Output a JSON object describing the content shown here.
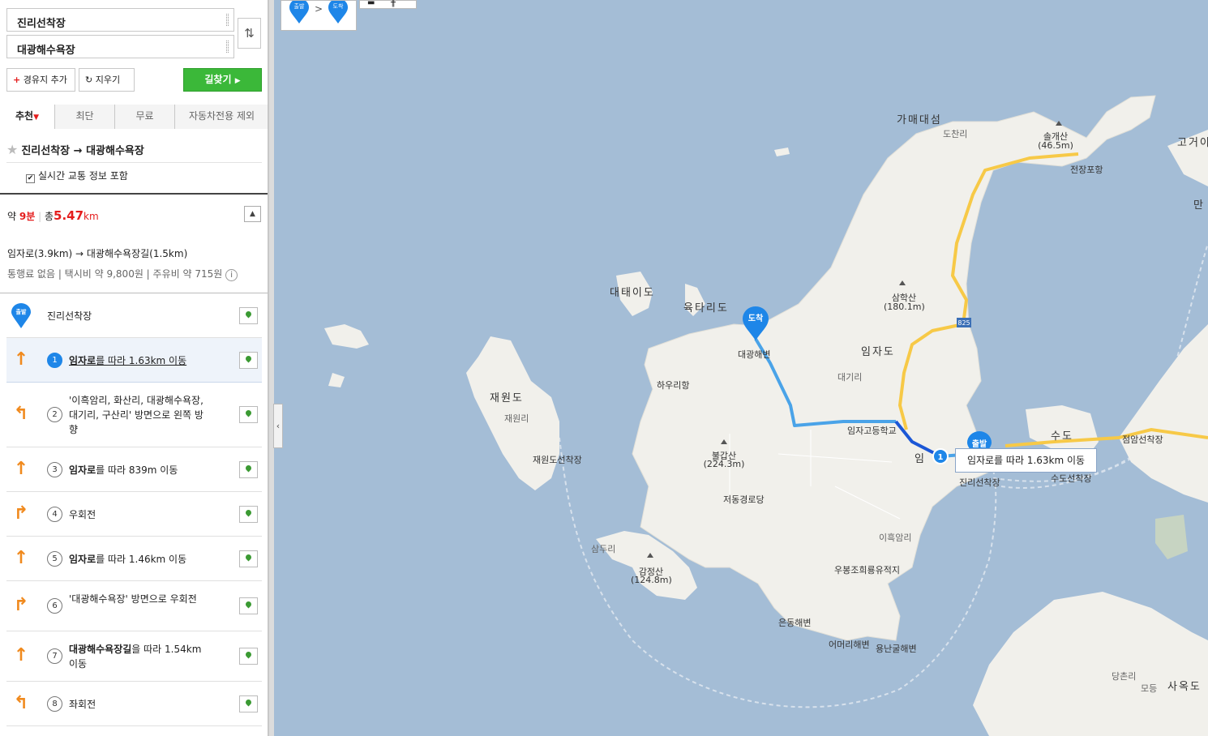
{
  "search": {
    "origin": "진리선착장",
    "destination": "대광해수욕장",
    "add_waypoint": "경유지 추가",
    "clear": "지우기",
    "find_route": "길찾기"
  },
  "tabs": [
    "추천",
    "최단",
    "무료",
    "자동차전용 제외"
  ],
  "route": {
    "title": "진리선착장 → 대광해수욕장",
    "realtime_traffic": "실시간 교통 정보 포함",
    "time_prefix": "약",
    "time": "9분",
    "dist_prefix": "총",
    "distance": "5.47",
    "distance_unit": "km",
    "via": "임자로(3.9km) → 대광해수욕장길(1.5km)",
    "fees": "통행료 없음 | 택시비 약 9,800원 | 주유비 약 715원"
  },
  "steps": [
    {
      "num": "",
      "type": "start",
      "road": "",
      "text": "진리선착장"
    },
    {
      "num": "1",
      "type": "straight",
      "road": "임자로",
      "text": "를 따라 1.63km 이동"
    },
    {
      "num": "2",
      "type": "left-slight",
      "road": "",
      "text": "'이흑암리, 화산리, 대광해수욕장, 대기리, 구산리' 방면으로 왼쪽 방향"
    },
    {
      "num": "3",
      "type": "straight",
      "road": "임자로",
      "text": "를 따라 839m 이동"
    },
    {
      "num": "4",
      "type": "right",
      "road": "",
      "text": "우회전"
    },
    {
      "num": "5",
      "type": "straight",
      "road": "임자로",
      "text": "를 따라 1.46km 이동"
    },
    {
      "num": "6",
      "type": "right",
      "road": "",
      "text": "'대광해수욕장' 방면으로 우회전"
    },
    {
      "num": "7",
      "type": "straight",
      "road": "대광해수욕장길",
      "text": "을 따라 1.54km 이동"
    },
    {
      "num": "8",
      "type": "left",
      "road": "",
      "text": "좌회전"
    }
  ],
  "map": {
    "legend_start": "출발",
    "legend_end": "도착",
    "tooltip": "임자로를 따라 1.63km 이동",
    "road_number": "825",
    "labels": [
      "가매대섬",
      "도찬리",
      "솔개산",
      "(46.5m)",
      "전장포항",
      "고거이",
      "만",
      "대태이도",
      "육타리도",
      "도착",
      "대광해변",
      "삼학산",
      "(180.1m)",
      "임자도",
      "대기리",
      "하우리항",
      "재원도",
      "재원리",
      "재원도선착장",
      "불갑산",
      "(224.3m)",
      "임자고등학교",
      "임",
      "출발",
      "진리선착장",
      "수도",
      "수도선착장",
      "점암선착장",
      "저동경로당",
      "이흑암리",
      "삼두리",
      "감정산",
      "(124.8m)",
      "우봉조희룡유적지",
      "은동해변",
      "어머리해변",
      "용난굴해변",
      "당촌리",
      "모등",
      "사옥도"
    ]
  },
  "colors": {
    "route": "#4aa3e8",
    "route_dark": "#1b57d6",
    "sea": "#a4bdd6",
    "land": "#f1f0eb",
    "accent_red": "#e41d1d",
    "go_green": "#3bb839"
  }
}
